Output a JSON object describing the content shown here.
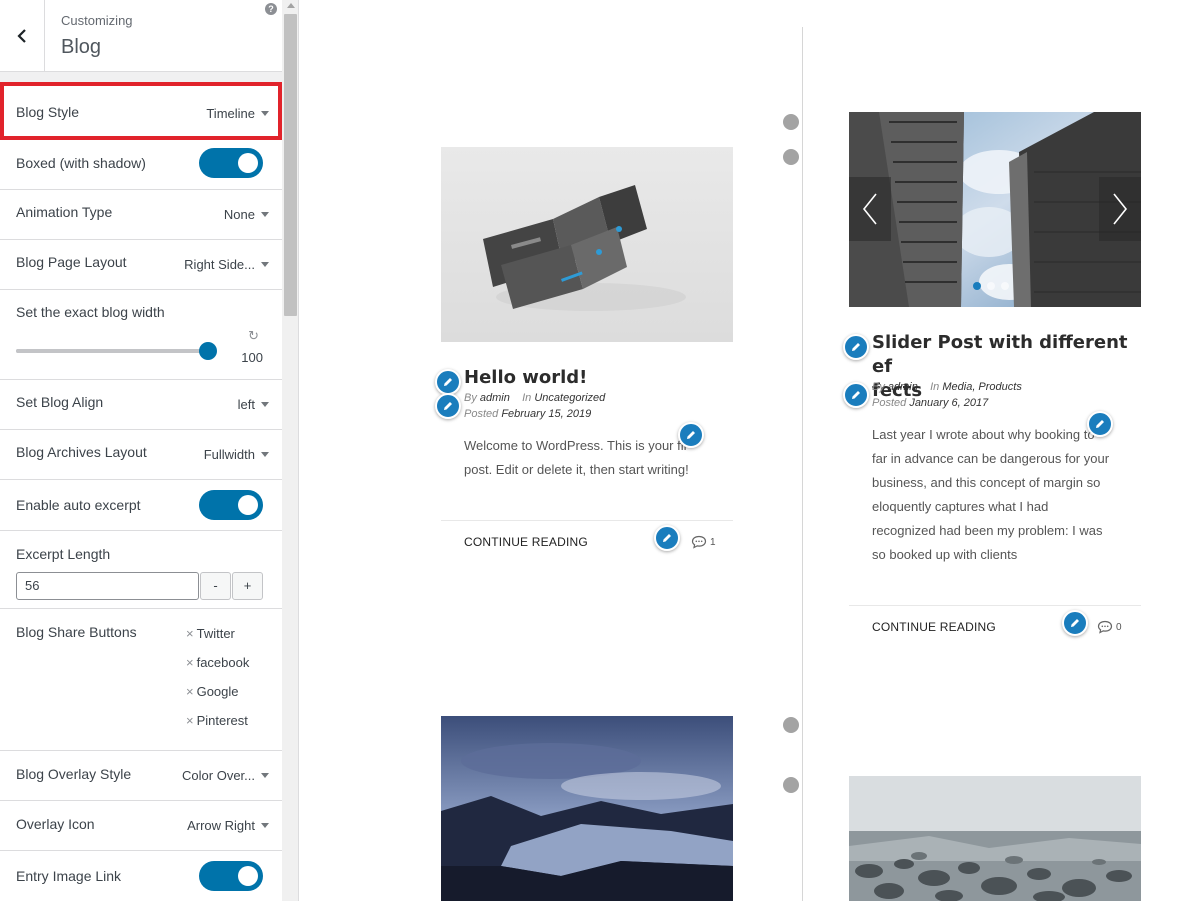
{
  "header": {
    "breadcrumb": "Customizing",
    "title": "Blog",
    "help_icon": "?"
  },
  "controls": {
    "blog_style": {
      "label": "Blog Style",
      "value": "Timeline"
    },
    "boxed": {
      "label": "Boxed (with shadow)",
      "enabled": true
    },
    "animation_type": {
      "label": "Animation Type",
      "value": "None"
    },
    "blog_page_layout": {
      "label": "Blog Page Layout",
      "value": "Right Side..."
    },
    "blog_width": {
      "label": "Set the exact blog width",
      "value": "100",
      "percent": 100
    },
    "blog_align": {
      "label": "Set Blog Align",
      "value": "left"
    },
    "archives_layout": {
      "label": "Blog Archives Layout",
      "value": "Fullwidth"
    },
    "auto_excerpt": {
      "label": "Enable auto excerpt",
      "enabled": true
    },
    "excerpt_length": {
      "label": "Excerpt Length",
      "value": "56",
      "minus": "-",
      "plus": "+"
    },
    "share_buttons": {
      "label": "Blog Share Buttons",
      "items": [
        "Twitter",
        "facebook",
        "Google",
        "Pinterest"
      ],
      "remove_glyph": "×"
    },
    "overlay_style": {
      "label": "Blog Overlay Style",
      "value": "Color Over..."
    },
    "overlay_icon": {
      "label": "Overlay Icon",
      "value": "Arrow Right"
    },
    "entry_image_link": {
      "label": "Entry Image Link",
      "enabled": true
    }
  },
  "posts": [
    {
      "title": "Hello world!",
      "by_label": "By",
      "author": "admin",
      "in_label": "In",
      "categories": "Uncategorized",
      "posted_label": "Posted",
      "date": "February 15, 2019",
      "excerpt_line1": "Welcome to WordPress. This is your fir",
      "excerpt_line2": "post. Edit or delete it, then start writing!",
      "continue": "CONTINUE READING",
      "comment_count": "1"
    },
    {
      "title_line1": "Slider Post with different ef",
      "title_line2": "fects",
      "by_label": "By",
      "author": "admin",
      "in_label": "In",
      "categories": "Media, Products",
      "posted_label": "Posted",
      "date": "January 6, 2017",
      "excerpt_lines": [
        "Last year I wrote about why booking to",
        "far in advance can be dangerous for your",
        "business, and this concept of margin so",
        "eloquently captures what I had",
        "recognized had been my problem: I was",
        "so booked up with clients"
      ],
      "continue": "CONTINUE READING",
      "comment_count": "0"
    }
  ],
  "colors": {
    "accent": "#0073aa",
    "highlight": "#e1232b",
    "edit_pen": "#1a7dbd",
    "timeline_dot": "#a3a3a3"
  },
  "icons": {
    "back": "chevron-left-icon",
    "edit": "pencil-icon",
    "comment": "comment-bubble-icon",
    "reset": "undo-icon"
  }
}
